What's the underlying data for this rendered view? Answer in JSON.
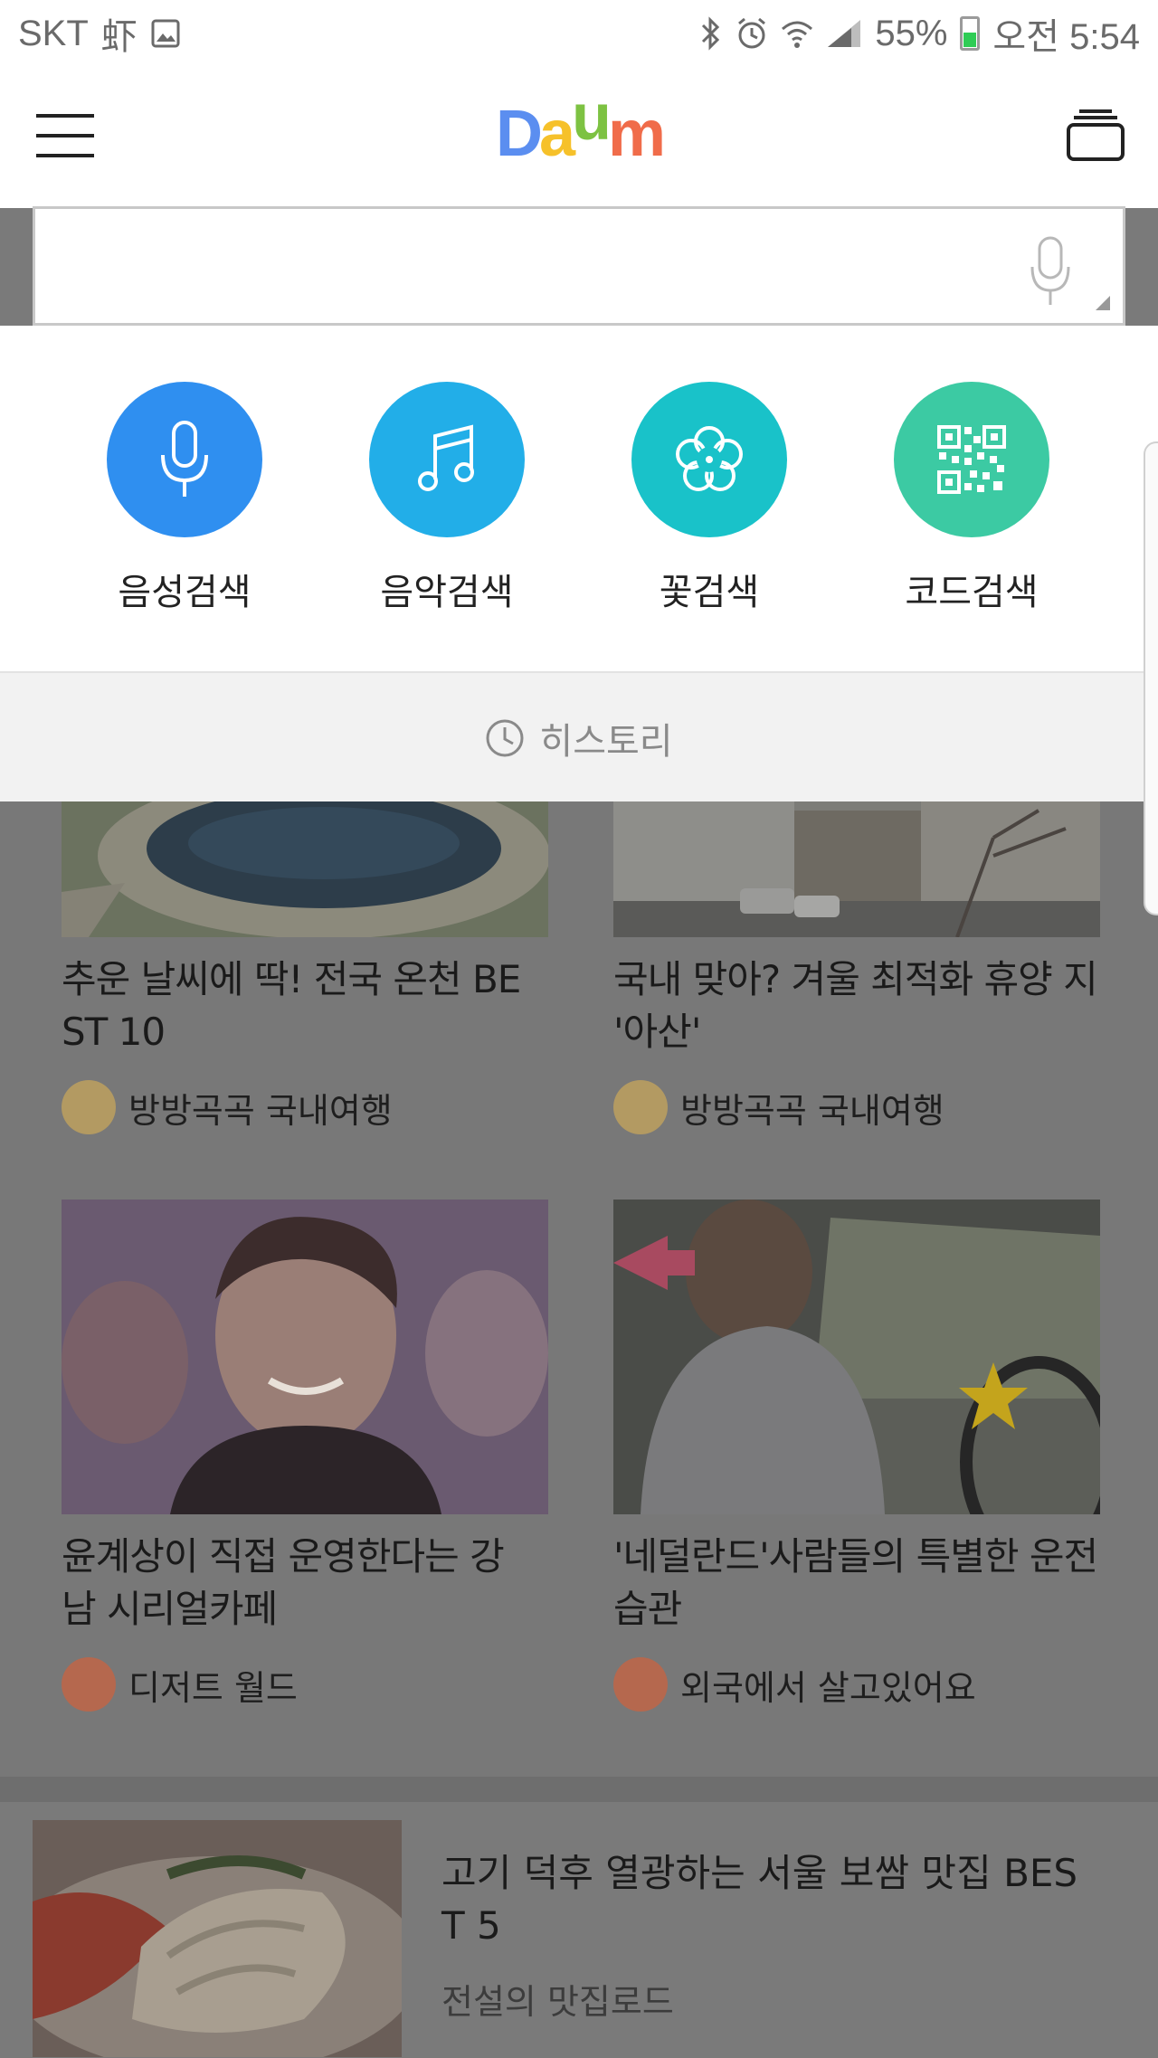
{
  "status_bar": {
    "carrier": "SKT",
    "carrier_glyph": "虾",
    "battery": "55%",
    "time": "오전 5:54",
    "icons": [
      "gallery-icon",
      "bluetooth-icon",
      "alarm-icon",
      "wifi-icon",
      "signal-icon",
      "battery-icon"
    ]
  },
  "header": {
    "logo": {
      "letters": [
        "D",
        "a",
        "u",
        "m"
      ],
      "colors": [
        "#5b8ef0",
        "#f6c12a",
        "#7dc242",
        "#f06c4a"
      ]
    },
    "icons": [
      "hamburger-menu-icon",
      "tabs-icon"
    ]
  },
  "search": {
    "placeholder": "",
    "value": ""
  },
  "search_modes": [
    {
      "label": "음성검색",
      "icon": "microphone-icon",
      "color": "#2f8ff0"
    },
    {
      "label": "음악검색",
      "icon": "music-note-icon",
      "color": "#22aee8"
    },
    {
      "label": "꽃검색",
      "icon": "flower-icon",
      "color": "#19c2c9"
    },
    {
      "label": "코드검색",
      "icon": "qr-code-icon",
      "color": "#3ccaa3"
    }
  ],
  "history": {
    "label": "히스토리",
    "icon": "clock-icon"
  },
  "feed": {
    "cards": [
      {
        "title": "추운 날씨에 딱! 전국 온천 BE ST 10",
        "source": "방방곡곡 국내여행",
        "image": "fountain-photo"
      },
      {
        "title": "국내 맞아? 겨울 최적화 휴양 지 '아산'",
        "source": "방방곡곡 국내여행",
        "image": "street-photo"
      },
      {
        "title": "윤계상이 직접 운영한다는 강 남 시리얼카페",
        "source": "디저트 월드",
        "image": "portrait-photo"
      },
      {
        "title": "'네덜란드'사람들의 특별한 운전습관",
        "source": "외국에서 살고있어요",
        "image": "driver-photo"
      }
    ],
    "list_item": {
      "title": "고기 덕후 열광하는 서울 보쌈 맛집 BES T 5",
      "source": "전설의 맛집로드",
      "image": "bossam-photo"
    }
  }
}
